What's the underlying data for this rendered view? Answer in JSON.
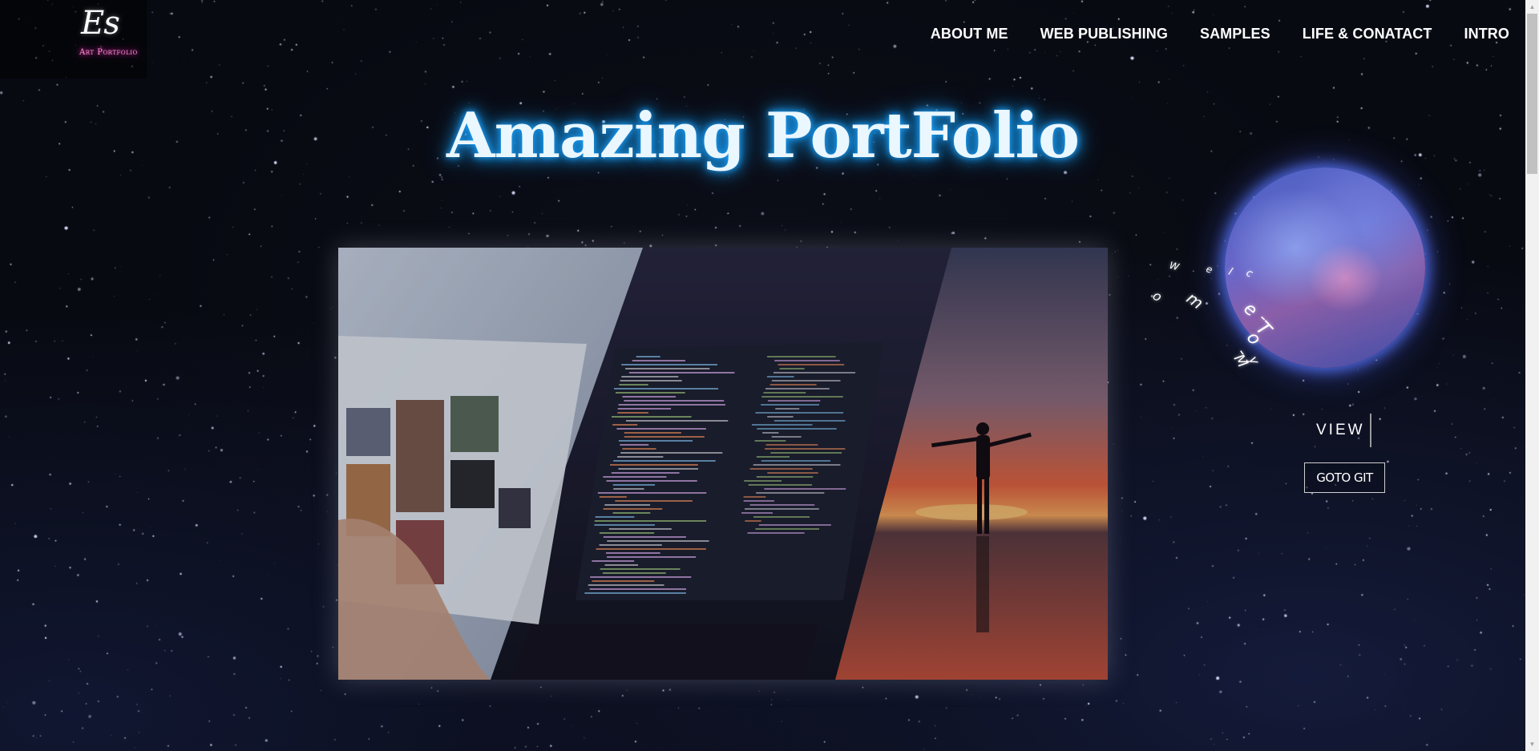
{
  "logo": {
    "mark": "Es",
    "subtitle": "Art Portfolio"
  },
  "nav": {
    "items": [
      {
        "label": "ABOUT ME"
      },
      {
        "label": "WEB PUBLISHING"
      },
      {
        "label": "SAMPLES"
      },
      {
        "label": "LIFE & CONATACT"
      },
      {
        "label": "INTRO"
      }
    ]
  },
  "hero": {
    "title": "Amazing PortFolio"
  },
  "planet": {
    "orbit_text": "Welcome-To-My"
  },
  "actions": {
    "view_label": "VIEW",
    "goto_label": "GOTO GIT"
  },
  "colors": {
    "title_glow": "#1aa3ff",
    "logo_sub_glow": "#ff3cbf",
    "background": "#070a14"
  }
}
